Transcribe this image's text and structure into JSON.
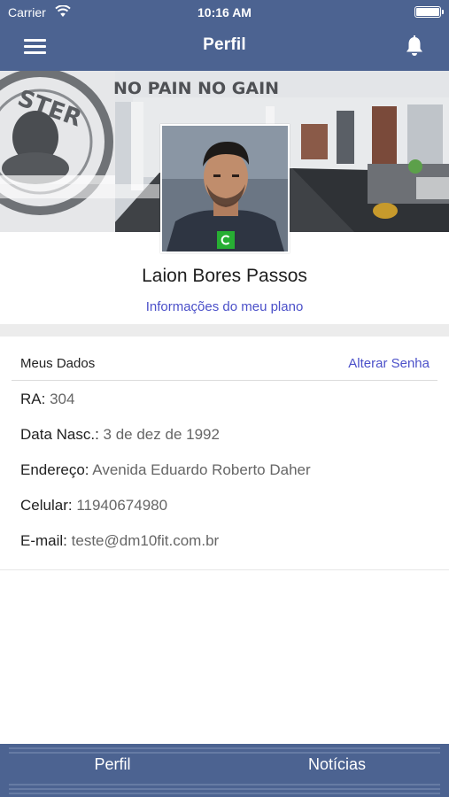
{
  "status_bar": {
    "carrier": "Carrier",
    "time": "10:16 AM"
  },
  "nav": {
    "title": "Perfil"
  },
  "profile": {
    "name": "Laion Bores Passos",
    "plan_link": "Informações do meu plano",
    "cover_sign": "NO PAIN NO GAIN",
    "logo_text": "STER"
  },
  "data_card": {
    "title": "Meus Dados",
    "change_password": "Alterar Senha",
    "fields": [
      {
        "label": "RA:",
        "value": "304"
      },
      {
        "label": "Data Nasc.:",
        "value": "3 de dez de 1992"
      },
      {
        "label": "Endereço:",
        "value": "Avenida Eduardo Roberto Daher"
      },
      {
        "label": "Celular:",
        "value": "11940674980"
      },
      {
        "label": "E-mail:",
        "value": "teste@dm10fit.com.br"
      }
    ]
  },
  "tabs": [
    {
      "label": "Perfil"
    },
    {
      "label": "Notícias"
    }
  ],
  "colors": {
    "header": "#4c6391",
    "link": "#4b50c9",
    "online": "#27ae33"
  }
}
